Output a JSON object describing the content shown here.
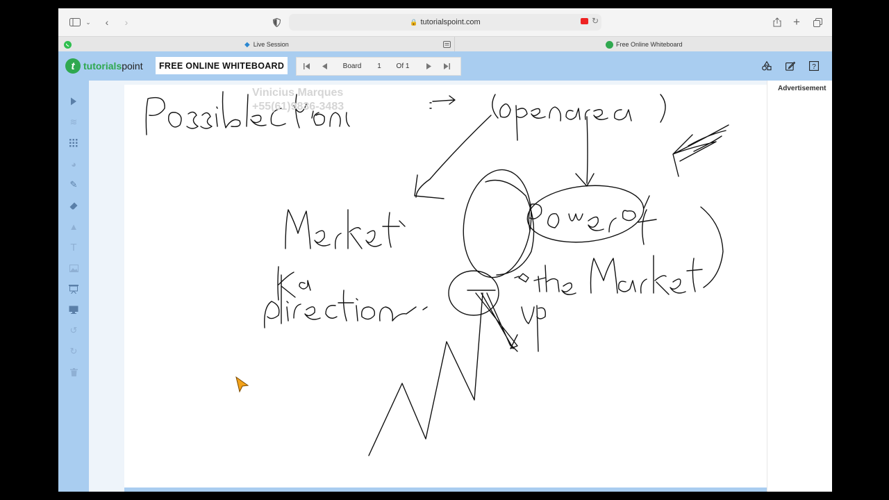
{
  "browser": {
    "url": "tutorialspoint.com",
    "tabs": [
      {
        "label": "Live Session"
      },
      {
        "label": "Free Online Whiteboard"
      }
    ]
  },
  "app": {
    "logo_main": "tutorials",
    "logo_suffix": "point",
    "title": "FREE ONLINE WHITEBOARD",
    "board_label": "Board",
    "board_number": "1",
    "board_total": "Of 1"
  },
  "sidebar": {
    "advertisement_label": "Advertisement"
  },
  "watermark": {
    "line1": "Vinicius Marques",
    "line2": "+55(61)9836-3483"
  },
  "colors": {
    "accent": "#a9cdf0",
    "logo_green": "#2fa84f",
    "record_red": "#e22222"
  },
  "icons": [
    "sidebar-icon",
    "back-icon",
    "forward-icon",
    "shield-icon",
    "lock-icon",
    "record-icon",
    "reload-icon",
    "share-icon",
    "plus-icon",
    "tabs-icon",
    "whatsapp-icon",
    "chat-icon",
    "pointer-icon",
    "layers-icon",
    "grid-icon",
    "palette-icon",
    "pencil-icon",
    "eraser-icon",
    "shapes-icon",
    "text-icon",
    "image-icon",
    "present-icon",
    "screen-icon",
    "undo-icon",
    "redo-icon",
    "trash-icon"
  ]
}
